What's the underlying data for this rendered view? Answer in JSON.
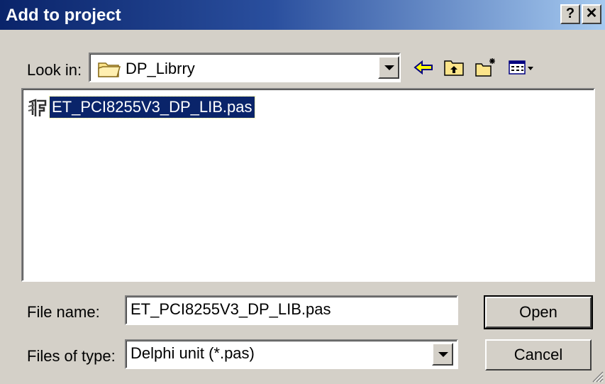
{
  "window": {
    "title": "Add to project",
    "help_glyph": "?",
    "close_glyph": "✕"
  },
  "lookin": {
    "label": "Look in:",
    "value": "DP_Librry",
    "icon": "folder-icon"
  },
  "toolbar": {
    "icons": [
      "back-icon",
      "up-folder-icon",
      "new-folder-icon",
      "view-menu-icon"
    ]
  },
  "files": [
    {
      "name": "ET_PCI8255V3_DP_LIB.pas",
      "icon": "delphi-unit-icon",
      "selected": true
    }
  ],
  "filename": {
    "label": "File name:",
    "value": "ET_PCI8255V3_DP_LIB.pas"
  },
  "filetype": {
    "label": "Files of type:",
    "value": "Delphi unit (*.pas)"
  },
  "buttons": {
    "open": "Open",
    "cancel": "Cancel"
  },
  "colors": {
    "titlebar_start": "#0a246a",
    "titlebar_end": "#a6caf0",
    "selection": "#0a246a",
    "face": "#d4d0c8"
  }
}
